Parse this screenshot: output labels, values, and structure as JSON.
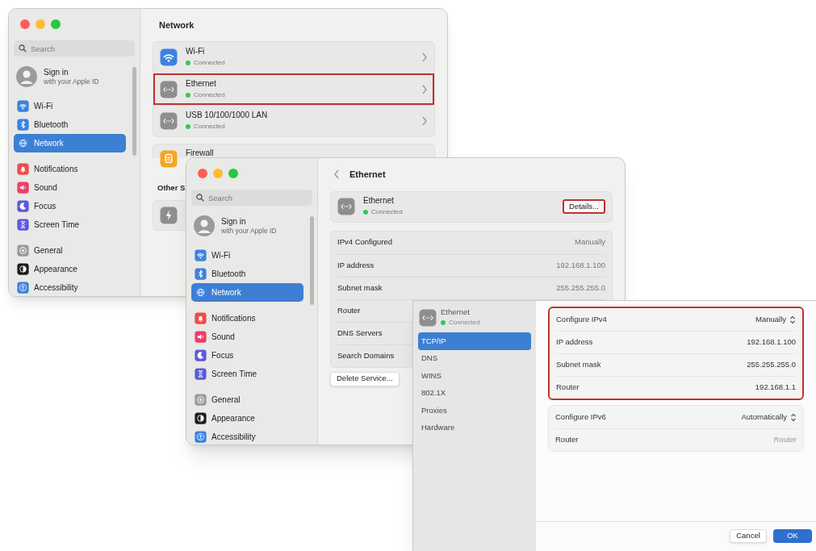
{
  "network_window": {
    "sidebar": {
      "search": {
        "placeholder": "Search"
      },
      "account": {
        "title": "Sign in",
        "subtitle": "with your Apple ID"
      },
      "groups": [
        {
          "items": [
            {
              "label": "Wi-Fi",
              "selected": false
            },
            {
              "label": "Bluetooth",
              "selected": false
            },
            {
              "label": "Network",
              "selected": true
            }
          ]
        },
        {
          "items": [
            {
              "label": "Notifications",
              "selected": false
            },
            {
              "label": "Sound",
              "selected": false
            },
            {
              "label": "Focus",
              "selected": false
            },
            {
              "label": "Screen Time",
              "selected": false
            }
          ]
        },
        {
          "items": [
            {
              "label": "General",
              "selected": false
            },
            {
              "label": "Appearance",
              "selected": false
            },
            {
              "label": "Accessibility",
              "selected": false
            }
          ]
        }
      ]
    },
    "title": "Network",
    "services": [
      {
        "name": "Wi-Fi",
        "status": "Connected",
        "highlighted": false
      },
      {
        "name": "Ethernet",
        "status": "Connected",
        "highlighted": true
      },
      {
        "name": "USB 10/100/1000 LAN",
        "status": "Connected",
        "highlighted": false
      }
    ],
    "firewall": "Firewall",
    "section_heading": "Other S"
  },
  "ethernet_window": {
    "sidebar": {
      "search": {
        "placeholder": "Search"
      },
      "account": {
        "title": "Sign in",
        "subtitle": "with your Apple ID"
      },
      "groups": [
        {
          "items": [
            {
              "label": "Wi-Fi",
              "selected": false
            },
            {
              "label": "Bluetooth",
              "selected": false
            },
            {
              "label": "Network",
              "selected": true
            }
          ]
        },
        {
          "items": [
            {
              "label": "Notifications",
              "selected": false
            },
            {
              "label": "Sound",
              "selected": false
            },
            {
              "label": "Focus",
              "selected": false
            },
            {
              "label": "Screen Time",
              "selected": false
            }
          ]
        },
        {
          "items": [
            {
              "label": "General",
              "selected": false
            },
            {
              "label": "Appearance",
              "selected": false
            },
            {
              "label": "Accessibility",
              "selected": false
            }
          ]
        }
      ]
    },
    "title": "Ethernet",
    "service": {
      "name": "Ethernet",
      "status": "Connected",
      "details_button": "Details...",
      "highlighted": true
    },
    "rows": [
      {
        "label": "IPv4 Configured",
        "value": "Manually"
      },
      {
        "label": "IP address",
        "value": "192.168.1.100"
      },
      {
        "label": "Subnet mask",
        "value": "255.255.255.0"
      },
      {
        "label": "Router"
      },
      {
        "label": "DNS Servers"
      },
      {
        "label": "Search Domains"
      }
    ],
    "delete_button": "Delete Service..."
  },
  "details_sheet": {
    "service": {
      "name": "Ethernet",
      "status": "Connected"
    },
    "tabs": [
      {
        "label": "TCP/IP",
        "selected": true
      },
      {
        "label": "DNS",
        "selected": false
      },
      {
        "label": "WINS",
        "selected": false
      },
      {
        "label": "802.1X",
        "selected": false
      },
      {
        "label": "Proxies",
        "selected": false
      },
      {
        "label": "Hardware",
        "selected": false
      }
    ],
    "groups": [
      {
        "highlighted": true,
        "rows": [
          {
            "kind": "popup",
            "label": "Configure IPv4",
            "value": "Manually"
          },
          {
            "kind": "value",
            "label": "IP address",
            "value": "192.168.1.100"
          },
          {
            "kind": "value",
            "label": "Subnet mask",
            "value": "255.255.255.0"
          },
          {
            "kind": "value",
            "label": "Router",
            "value": "192.168.1.1"
          }
        ]
      },
      {
        "highlighted": false,
        "rows": [
          {
            "kind": "popup",
            "label": "Configure IPv6",
            "value": "Automatically"
          },
          {
            "kind": "field",
            "label": "Router",
            "placeholder": "Router"
          }
        ]
      }
    ],
    "buttons": [
      {
        "label": "Cancel",
        "kind": "secondary"
      },
      {
        "label": "OK",
        "kind": "primary"
      }
    ]
  }
}
